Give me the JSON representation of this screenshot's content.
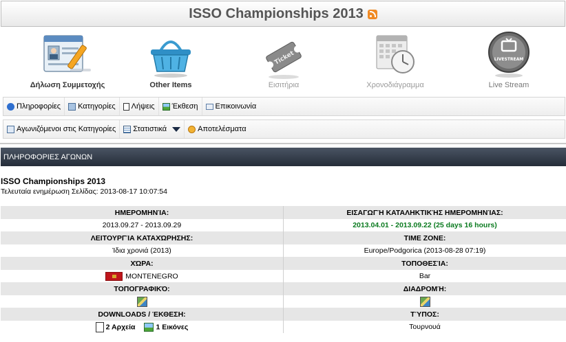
{
  "header": {
    "title": "ISSO Championships 2013"
  },
  "big_icons": [
    {
      "label": "Δήλωση Συμμετοχής",
      "icon": "registration-form-icon",
      "state": "active"
    },
    {
      "label": "Other Items",
      "icon": "shopping-basket-icon",
      "state": "active"
    },
    {
      "label": "Εισιτήρια",
      "icon": "ticket-icon",
      "state": "disabled"
    },
    {
      "label": "Χρονοδιάγραμμα",
      "icon": "schedule-calendar-clock-icon",
      "state": "disabled"
    },
    {
      "label": "Live Stream",
      "icon": "livestream-tv-icon",
      "state": "live"
    }
  ],
  "nav1": [
    {
      "label": "Πληροφορίες",
      "icon": "info-icon"
    },
    {
      "label": "Κατηγορίες",
      "icon": "folder-icon"
    },
    {
      "label": "Λήψεις",
      "icon": "document-icon"
    },
    {
      "label": "Έκθεση",
      "icon": "image-icon"
    },
    {
      "label": "Επικοινωνία",
      "icon": "mail-icon"
    }
  ],
  "nav2": [
    {
      "label": "Αγωνιζόμενοι στις Κατηγορίες",
      "icon": "edit-list-icon"
    },
    {
      "label": "Στατιστικά",
      "icon": "table-icon"
    },
    {
      "label": "Αποτελέσματα",
      "icon": "medal-icon"
    }
  ],
  "section": {
    "title": "ΠΛΗΡΟΦΟΡΙΕΣ ΑΓΩΝΩΝ"
  },
  "event": {
    "title": "ISSO Championships 2013",
    "updated": "Τελευταία ενημέρωση Σελίδας: 2013-08-17 10:07:54"
  },
  "info": {
    "date_label": "ΗΜΕΡΟΜΗΝΊΑ:",
    "date_value": "2013.09.27 - 2013.09.29",
    "deadline_label": "ΕΙΣΑΓΩΓΉ ΚΑΤΑΛΗΚΤΙΚΉΣ ΗΜΕΡΟΜΗΝΊΑΣ:",
    "deadline_value": "2013.04.01 - 2013.09.22 (25 days 16 hours)",
    "deadline_color": "#0a7a1f",
    "registration_label": "ΛΕΙΤΟΥΡΓΊΑ ΚΑΤΑΧΏΡΗΣΗΣ:",
    "registration_value": "Ίδια χρονιά (2013)",
    "timezone_label": "TIME ZONE:",
    "timezone_value": "Europe/Podgorica (2013-08-28 07:19)",
    "country_label": "ΧΏΡΑ:",
    "country_value": "MONTENEGRO",
    "location_label": "ΤΟΠΟΘΕΣΊΑ:",
    "location_value": "Bar",
    "topo_label": "ΤΟΠΟΓΡΑΦΙΚΌ:",
    "route_label": "ΔΙΑΔΡΟΜΉ:",
    "downloads_label": "DOWNLOADS / ΈΚΘΕΣΗ:",
    "downloads_files": "2 Αρχεία",
    "downloads_images": "1 Εικόνες",
    "type_label": "ΤΎΠΟΣ:",
    "type_value": "Τουρνουά"
  },
  "colors": {
    "section_bar": "#2f3845",
    "label_row": "#e6e6e6",
    "rss": "#f08a24"
  }
}
